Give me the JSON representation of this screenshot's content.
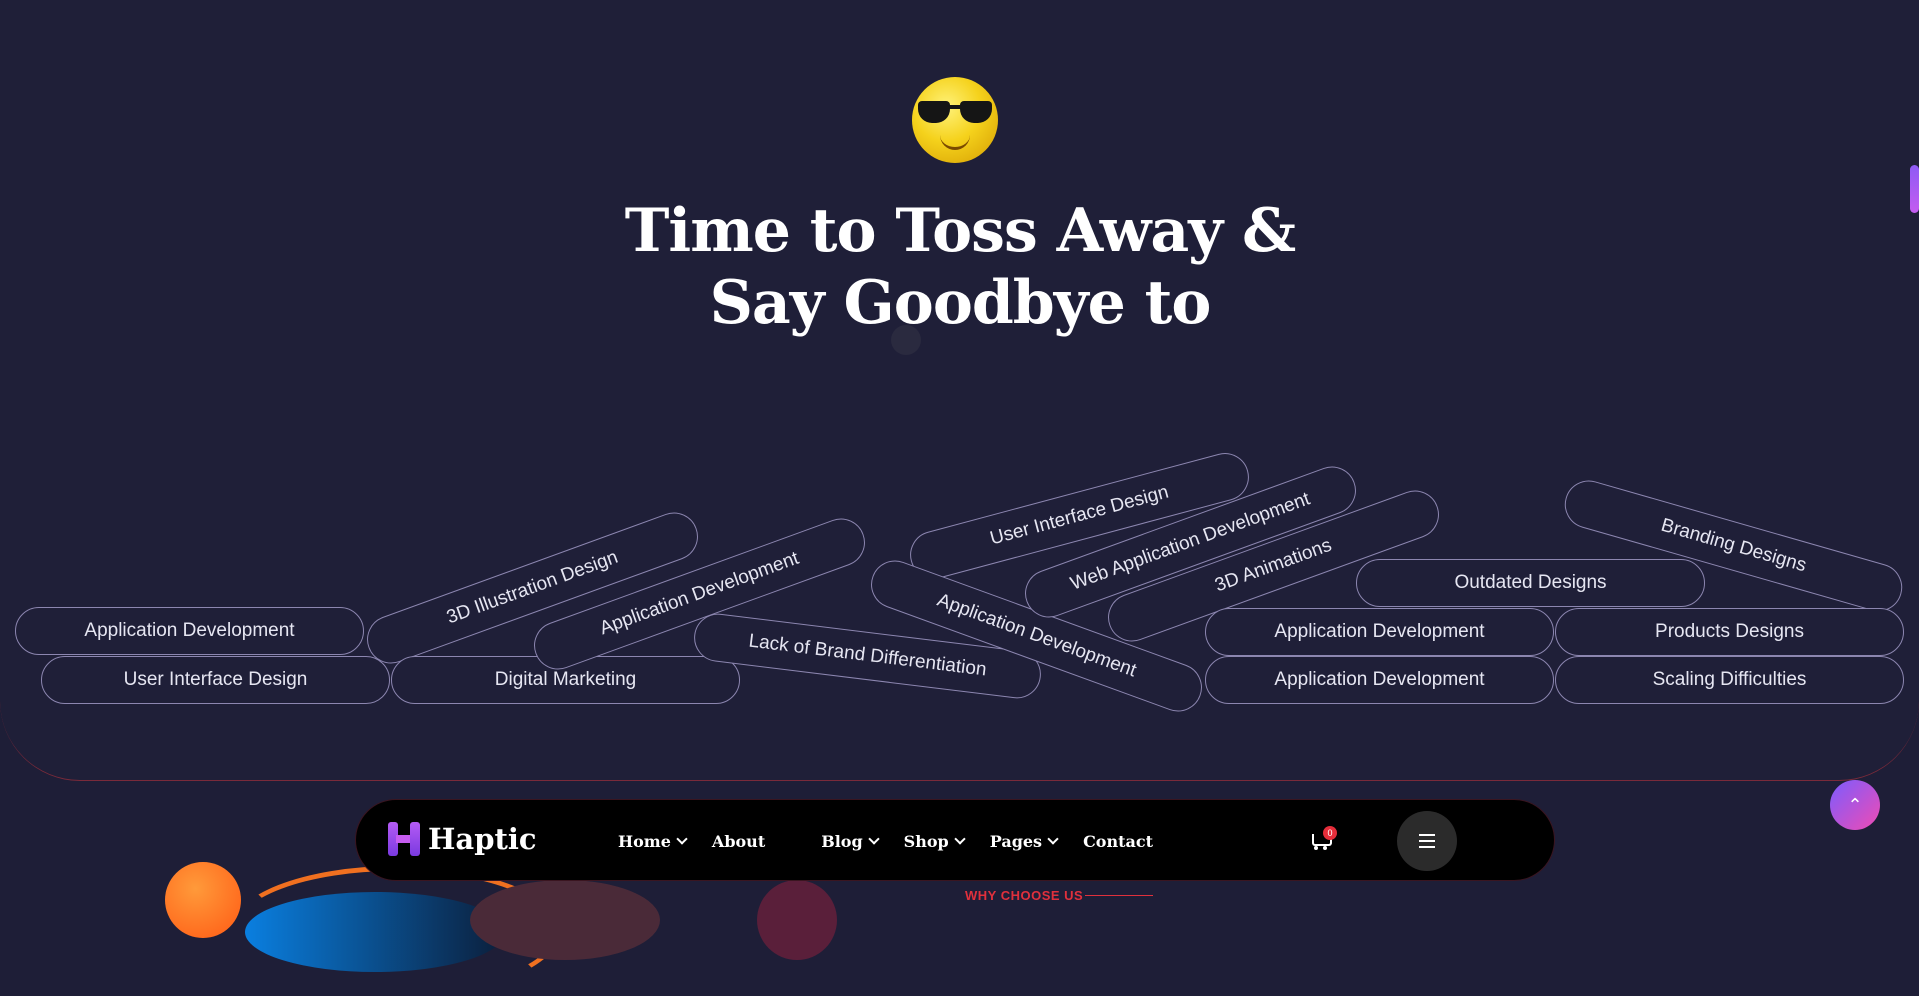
{
  "hero": {
    "title_line1": "Time to Toss Away &",
    "title_line2": "Say Goodbye to",
    "emoji_icon": "sunglasses-face-emoji",
    "pills": [
      {
        "label": "Application Development"
      },
      {
        "label": "User Interface Design"
      },
      {
        "label": "3D Illustration Design"
      },
      {
        "label": "Digital Marketing"
      },
      {
        "label": "Application Development"
      },
      {
        "label": "Lack of Brand Differentiation"
      },
      {
        "label": "User Interface Design"
      },
      {
        "label": "Application Development"
      },
      {
        "label": "Web Application Development"
      },
      {
        "label": "3D Animations"
      },
      {
        "label": "Application Development"
      },
      {
        "label": "Application Development"
      },
      {
        "label": "Outdated Designs"
      },
      {
        "label": "Branding Designs"
      },
      {
        "label": "Products Designs"
      },
      {
        "label": "Scaling Difficulties"
      }
    ]
  },
  "navbar": {
    "logo_text": "Haptic",
    "items": [
      {
        "label": "Home"
      },
      {
        "label": "About"
      },
      {
        "label": "Blog"
      },
      {
        "label": "Shop"
      },
      {
        "label": "Pages"
      },
      {
        "label": "Contact"
      }
    ],
    "cart_count": "0"
  },
  "next_section": {
    "eyebrow": "WHY CHOOSE US"
  },
  "colors": {
    "background": "#1f1f38",
    "accent_red": "#e0303c",
    "accent_purple": "#8e5bf5"
  }
}
